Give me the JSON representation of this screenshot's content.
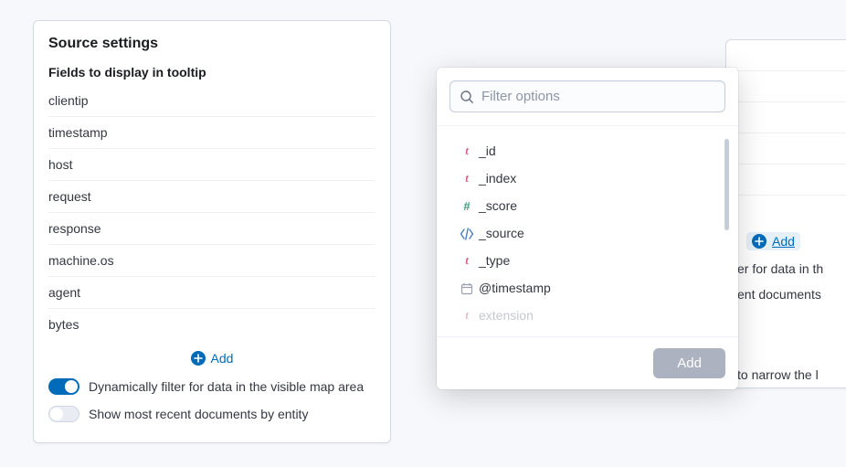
{
  "leftPanel": {
    "title": "Source settings",
    "subtitle": "Fields to display in tooltip",
    "fields": [
      "clientip",
      "timestamp",
      "host",
      "request",
      "response",
      "machine.os",
      "agent",
      "bytes"
    ],
    "addLabel": "Add",
    "toggle1": {
      "label": "Dynamically filter for data in the visible map area",
      "on": true
    },
    "toggle2": {
      "label": "Show most recent documents by entity",
      "on": false
    }
  },
  "popover": {
    "searchPlaceholder": "Filter options",
    "options": [
      {
        "typeIcon": "t",
        "label": "_id"
      },
      {
        "typeIcon": "t",
        "label": "_index"
      },
      {
        "typeIcon": "hash",
        "label": "_score"
      },
      {
        "typeIcon": "code",
        "label": "_source"
      },
      {
        "typeIcon": "t",
        "label": "_type"
      },
      {
        "typeIcon": "cal",
        "label": "@timestamp"
      },
      {
        "typeIcon": "t",
        "label": "extension",
        "faded": true
      }
    ],
    "footerAddLabel": "Add"
  },
  "bgPanel": {
    "addLabel": "Add",
    "text1": "er for data in th",
    "text2": "ent documents",
    "text3": "to narrow the l"
  }
}
